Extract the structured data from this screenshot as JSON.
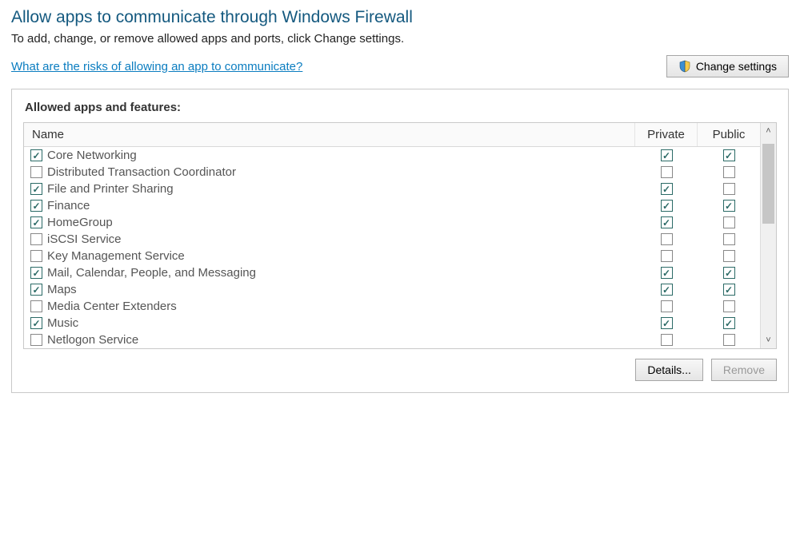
{
  "title": "Allow apps to communicate through Windows Firewall",
  "subtitle": "To add, change, or remove allowed apps and ports, click Change settings.",
  "risk_link": "What are the risks of allowing an app to communicate?",
  "change_settings_label": "Change settings",
  "panel_label": "Allowed apps and features:",
  "columns": {
    "name": "Name",
    "private": "Private",
    "public": "Public"
  },
  "details_label": "Details...",
  "remove_label": "Remove",
  "rows": [
    {
      "name": "Core Networking",
      "enabled": true,
      "private": true,
      "public": true
    },
    {
      "name": "Distributed Transaction Coordinator",
      "enabled": false,
      "private": false,
      "public": false
    },
    {
      "name": "File and Printer Sharing",
      "enabled": true,
      "private": true,
      "public": false
    },
    {
      "name": "Finance",
      "enabled": true,
      "private": true,
      "public": true
    },
    {
      "name": "HomeGroup",
      "enabled": true,
      "private": true,
      "public": false
    },
    {
      "name": "iSCSI Service",
      "enabled": false,
      "private": false,
      "public": false
    },
    {
      "name": "Key Management Service",
      "enabled": false,
      "private": false,
      "public": false
    },
    {
      "name": "Mail, Calendar, People, and Messaging",
      "enabled": true,
      "private": true,
      "public": true
    },
    {
      "name": "Maps",
      "enabled": true,
      "private": true,
      "public": true
    },
    {
      "name": "Media Center Extenders",
      "enabled": false,
      "private": false,
      "public": false
    },
    {
      "name": "Music",
      "enabled": true,
      "private": true,
      "public": true
    },
    {
      "name": "Netlogon Service",
      "enabled": false,
      "private": false,
      "public": false
    }
  ]
}
